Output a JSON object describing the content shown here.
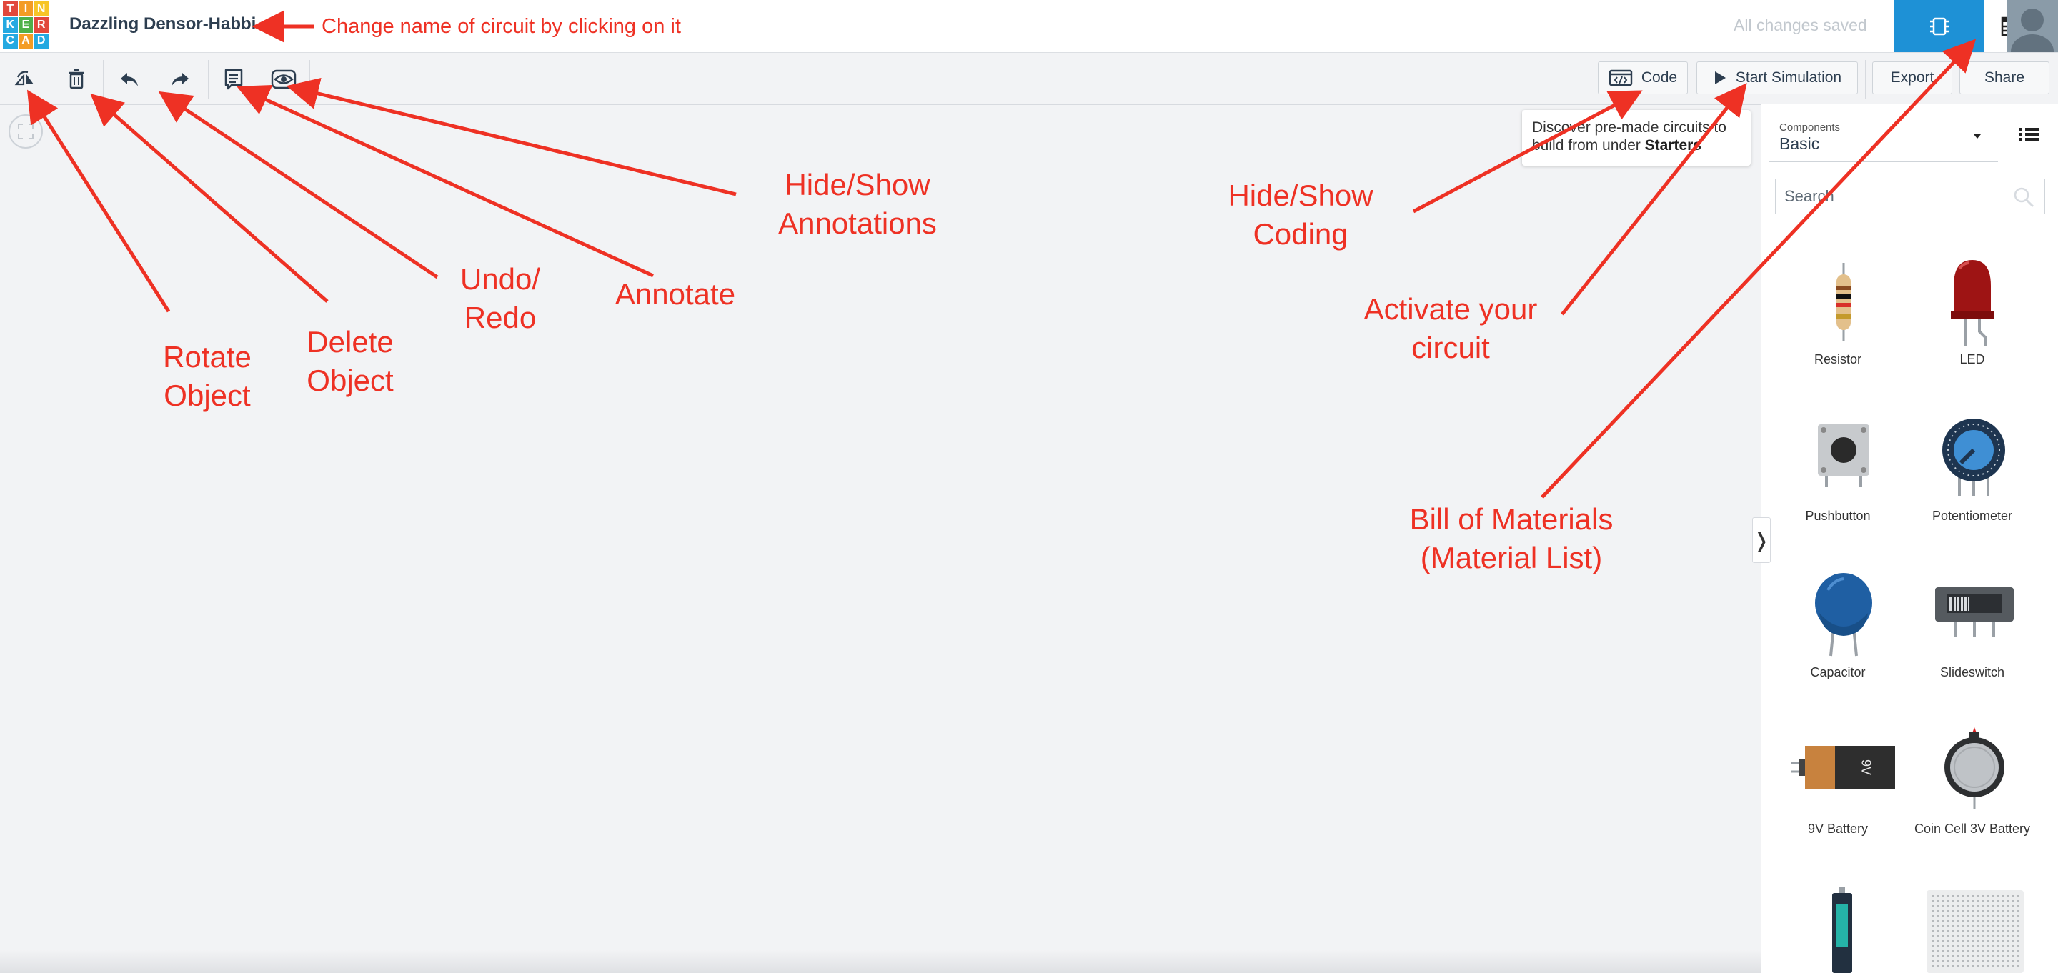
{
  "header": {
    "logo_letters": [
      "T",
      "I",
      "N",
      "K",
      "E",
      "R",
      "C",
      "A",
      "D"
    ],
    "logo_colors": [
      "#e1483c",
      "#f39c25",
      "#f7c527",
      "#24a9e1",
      "#4eb04a",
      "#e1483c",
      "#24a9e1",
      "#f39c25",
      "#24a9e1"
    ],
    "circuit_name": "Dazzling Densor-Habbi",
    "save_status": "All changes saved",
    "circuit_view_icon": "chip-icon",
    "bom_icon": "table-list-icon",
    "avatar_icon": "user-avatar-icon"
  },
  "toolbar": {
    "tools": [
      "rotate-icon",
      "trash-icon",
      "undo-icon",
      "redo-icon",
      "annotate-icon",
      "eye-icon"
    ],
    "code_label": "Code",
    "simulation_label": "Start Simulation",
    "export_label": "Export",
    "share_label": "Share"
  },
  "tooltip": {
    "text": "Discover pre-made circuits to build from under",
    "bold": "Starters"
  },
  "panel": {
    "components_label": "Components",
    "components_value": "Basic",
    "search_placeholder": "Search",
    "collapse_glyph": "❭",
    "components": [
      {
        "name": "Resistor"
      },
      {
        "name": "LED"
      },
      {
        "name": "Pushbutton"
      },
      {
        "name": "Potentiometer"
      },
      {
        "name": "Capacitor"
      },
      {
        "name": "Slideswitch"
      },
      {
        "name": "9V Battery",
        "marking": "9V"
      },
      {
        "name": "Coin Cell 3V Battery"
      }
    ]
  },
  "annotations": {
    "rename": "Change name of circuit by clicking on it",
    "rotate": [
      "Rotate",
      "Object"
    ],
    "delete": [
      "Delete",
      "Object"
    ],
    "undo_redo": [
      "Undo/",
      "Redo"
    ],
    "annotate": "Annotate",
    "hide_annotations": [
      "Hide/Show",
      "Annotations"
    ],
    "hide_coding": [
      "Hide/Show",
      "Coding"
    ],
    "activate": [
      "Activate your",
      "circuit"
    ],
    "bom": [
      "Bill of Materials",
      "(Material List)"
    ],
    "color": "#ee3124"
  }
}
